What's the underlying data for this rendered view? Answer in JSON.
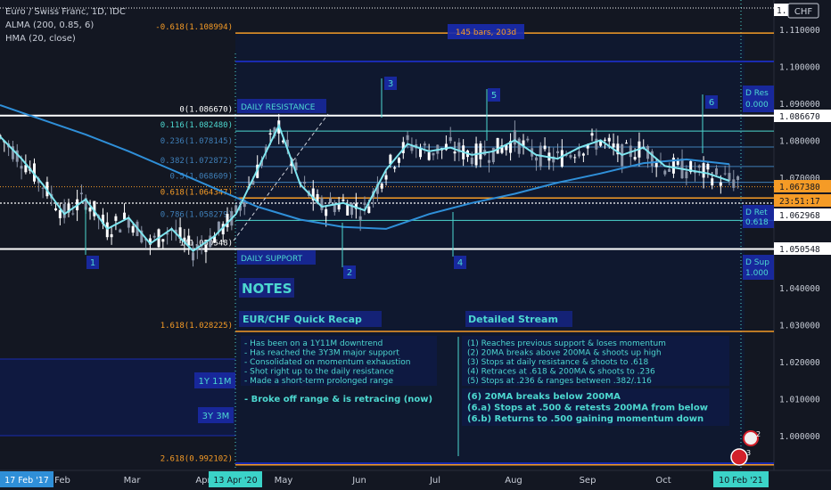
{
  "header": {
    "symbol_line": "Euro / Swiss Franc, 1D, IDC",
    "indicator_1": "ALMA (200, 0.85, 6)",
    "indicator_2": "HMA (20, close)",
    "currency_button": "CHF"
  },
  "range_box": {
    "label": "145 bars, 203d"
  },
  "level_labels": {
    "daily_resistance": "DAILY RESISTANCE",
    "daily_support": "DAILY SUPPORT",
    "d_res": "D Res",
    "d_res_val": "0.000",
    "d_ret": "D Ret",
    "d_ret_val": "0.618",
    "d_sup": "D Sup",
    "d_sup_val": "1.000"
  },
  "fib_labels": [
    {
      "text": "-0.618(1.108994)",
      "price": 1.108994,
      "color": "#f59b26"
    },
    {
      "text": "0(1.086670)",
      "price": 1.08667,
      "color": "#ffffff"
    },
    {
      "text": "0.116(1.082480)",
      "price": 1.08248,
      "color": "#4dd8d0"
    },
    {
      "text": "0.236(1.078145)",
      "price": 1.078145,
      "color": "#3f7fb8"
    },
    {
      "text": "0.382(1.072872)",
      "price": 1.072872,
      "color": "#3f7fb8"
    },
    {
      "text": "0.5(1.068609)",
      "price": 1.068609,
      "color": "#3f7fb8"
    },
    {
      "text": "0.618(1.064347)",
      "price": 1.064347,
      "color": "#f59b26"
    },
    {
      "text": "0.786(1.058279)",
      "price": 1.058279,
      "color": "#3f7fb8"
    },
    {
      "text": "1(1.050548)",
      "price": 1.050548,
      "color": "#ffffff"
    },
    {
      "text": "1.618(1.028225)",
      "price": 1.028225,
      "color": "#f59b26"
    },
    {
      "text": "2.618(0.992102)",
      "price": 0.992102,
      "color": "#f59b26"
    }
  ],
  "price_axis": {
    "ticks": [
      "1.110000",
      "1.100000",
      "1.090000",
      "1.080000",
      "1.070000",
      "1.040000",
      "1.030000",
      "1.020000",
      "1.010000",
      "1.000000"
    ],
    "top_tag": "1.1",
    "tags": [
      {
        "text": "1.086670",
        "bg": "#ffffff",
        "fg": "#131722"
      },
      {
        "text": "1.067380",
        "bg": "#f59b26",
        "fg": "#131722"
      },
      {
        "text": "23:51:17",
        "bg": "#f59b26",
        "fg": "#131722"
      },
      {
        "text": "1.062968",
        "bg": "#ffffff",
        "fg": "#131722"
      },
      {
        "text": "1.050548",
        "bg": "#ffffff",
        "fg": "#131722"
      }
    ]
  },
  "time_axis": {
    "left_tag": "17 Feb '17",
    "mid_tag": "13 Apr '20",
    "right_tag": "10 Feb '21",
    "months": [
      "Feb",
      "Mar",
      "Apr",
      "May",
      "Jun",
      "Jul",
      "Aug",
      "Sep",
      "Oct"
    ]
  },
  "markers": {
    "m1": "1",
    "m2": "2",
    "m3": "3",
    "m4": "4",
    "m5": "5",
    "m6": "6"
  },
  "notes": {
    "title": "NOTES",
    "recap_title": "EUR/CHF  Quick Recap",
    "stream_title": "Detailed Stream",
    "recap_lines": [
      "- Has been on a 1Y11M downtrend",
      "- Has reached the 3Y3M major support",
      "- Consolidated on momentum exhaustion",
      "- Shot right up to the daily resistance",
      "- Made a short-term prolonged range"
    ],
    "recap_last": "- Broke off range & is retracing (now)",
    "stream_lines": [
      "(1) Reaches previous support & loses momentum",
      "(2) 20MA breaks above 200MA & shoots up high",
      "(3) Stops at daily resistance & shoots to .618",
      "(4) Retraces at .618 & 200MA & shoots to .236",
      "(5) Stops at .236 & ranges between .382/.116"
    ],
    "stream_bold": [
      "(6) 20MA breaks below 200MA",
      "(6.a) Stops at .500 & retests 200MA from below",
      "(6.b) Returns to .500 gaining momentum down"
    ],
    "label_1y11m": "1Y 11M",
    "label_3y3m": "3Y 3M"
  },
  "badges": {
    "b1": "2",
    "b2": "3"
  },
  "colors": {
    "background": "#131722",
    "fib_orange": "#f59b26",
    "cyan": "#4dd8d0",
    "blue": "#3f7fb8",
    "alma": "#2f8fd8",
    "hma": "#7fe6f0",
    "up_candle": "#ffffff",
    "down_candle": "#8a93a6",
    "navy_box": "#1a2bb0"
  },
  "chart_data": {
    "type": "candlestick",
    "title": "Euro / Swiss Franc, 1D, IDC",
    "ylim": [
      0.989,
      1.113
    ],
    "x_labels": [
      "Feb",
      "Mar",
      "Apr",
      "May",
      "Jun",
      "Jul",
      "Aug",
      "Sep",
      "Oct"
    ],
    "series": [
      {
        "name": "ALMA (200, 0.85, 6)",
        "x_index": [
          0,
          20,
          40,
          60,
          80,
          100,
          120,
          140,
          160,
          180,
          200,
          220,
          240,
          260,
          280,
          300,
          320,
          340
        ],
        "values": [
          1.0895,
          1.0855,
          1.0815,
          1.077,
          1.072,
          1.067,
          1.062,
          1.0585,
          1.0565,
          1.056,
          1.06,
          1.063,
          1.0655,
          1.0685,
          1.071,
          1.0738,
          1.0748,
          1.0735
        ]
      },
      {
        "name": "HMA (20, close)",
        "x_index": [
          0,
          10,
          20,
          30,
          40,
          50,
          60,
          70,
          80,
          90,
          100,
          110,
          120,
          130,
          140,
          150,
          160,
          170,
          180,
          190,
          200,
          210,
          220,
          230,
          240,
          250,
          260,
          270,
          280,
          290,
          300,
          310,
          320,
          330,
          340
        ],
        "values": [
          1.081,
          1.075,
          1.068,
          1.06,
          1.064,
          1.056,
          1.059,
          1.052,
          1.056,
          1.05,
          1.054,
          1.06,
          1.072,
          1.084,
          1.068,
          1.062,
          1.063,
          1.061,
          1.072,
          1.079,
          1.077,
          1.078,
          1.076,
          1.077,
          1.08,
          1.076,
          1.075,
          1.078,
          1.08,
          1.076,
          1.078,
          1.073,
          1.072,
          1.071,
          1.069
        ]
      }
    ],
    "fib_levels": [
      1.108994,
      1.08667,
      1.08248,
      1.078145,
      1.072872,
      1.068609,
      1.064347,
      1.058279,
      1.050548,
      1.028225,
      0.992102
    ],
    "horizontal_levels": [
      1.08667,
      1.062968,
      1.050548,
      1.06738
    ]
  }
}
